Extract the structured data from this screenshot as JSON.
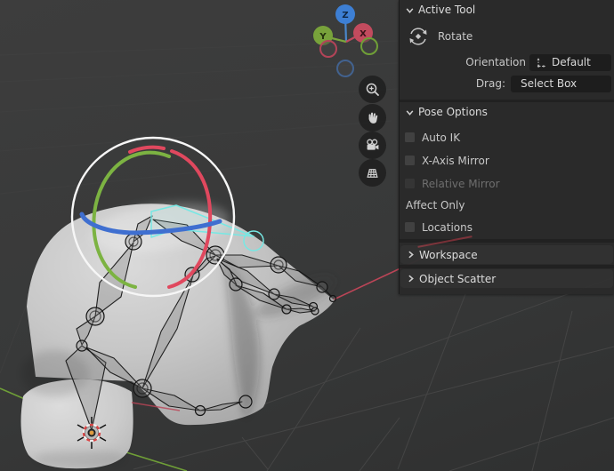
{
  "sidebar": {
    "active_tool_panel": {
      "title": "Active Tool",
      "tool": {
        "name": "Rotate",
        "icon": "rotate-icon"
      },
      "fields": {
        "orientation_label": "Orientation",
        "orientation_value": "Default",
        "orientation_icon": "orientation-gizmo-icon",
        "drag_label": "Drag:",
        "drag_value": "Select Box"
      }
    },
    "pose_options_panel": {
      "title": "Pose Options",
      "checkboxes": [
        {
          "label": "Auto IK",
          "checked": false,
          "enabled": true
        },
        {
          "label": "X-Axis Mirror",
          "checked": false,
          "enabled": true
        },
        {
          "label": "Relative Mirror",
          "checked": false,
          "enabled": false
        }
      ],
      "affect_only_label": "Affect Only",
      "locations_checkbox": {
        "label": "Locations",
        "checked": false
      }
    },
    "collapsed_panels": [
      {
        "label": "Workspace"
      },
      {
        "label": "Object Scatter"
      }
    ]
  },
  "viewport": {
    "nav_gizmo": {
      "axes": {
        "x": "X",
        "y": "Y",
        "z": "Z"
      }
    },
    "tool_buttons": [
      {
        "name": "zoom",
        "icon": "magnifier-plus-icon"
      },
      {
        "name": "pan",
        "icon": "hand-icon"
      },
      {
        "name": "camera-view",
        "icon": "camera-icon"
      },
      {
        "name": "toggle-projection",
        "icon": "grid-perspective-icon"
      }
    ],
    "selected_tool": "Rotate",
    "colors": {
      "axis_x_red": "#bb4557",
      "axis_y_green": "#6f9f37",
      "axis_z_blue": "#3d7fd4",
      "gizmo_arc_red": "#e0485e",
      "gizmo_arc_green": "#7cb342",
      "gizmo_arc_blue": "#3f6fd0",
      "selected_bone_cyan": "#76e8e4",
      "gizmo_ring_white": "#f6f6f6",
      "grid_line": "#474747",
      "panel_background": "#292929",
      "cursor_center_orange": "#e09c3f"
    }
  }
}
